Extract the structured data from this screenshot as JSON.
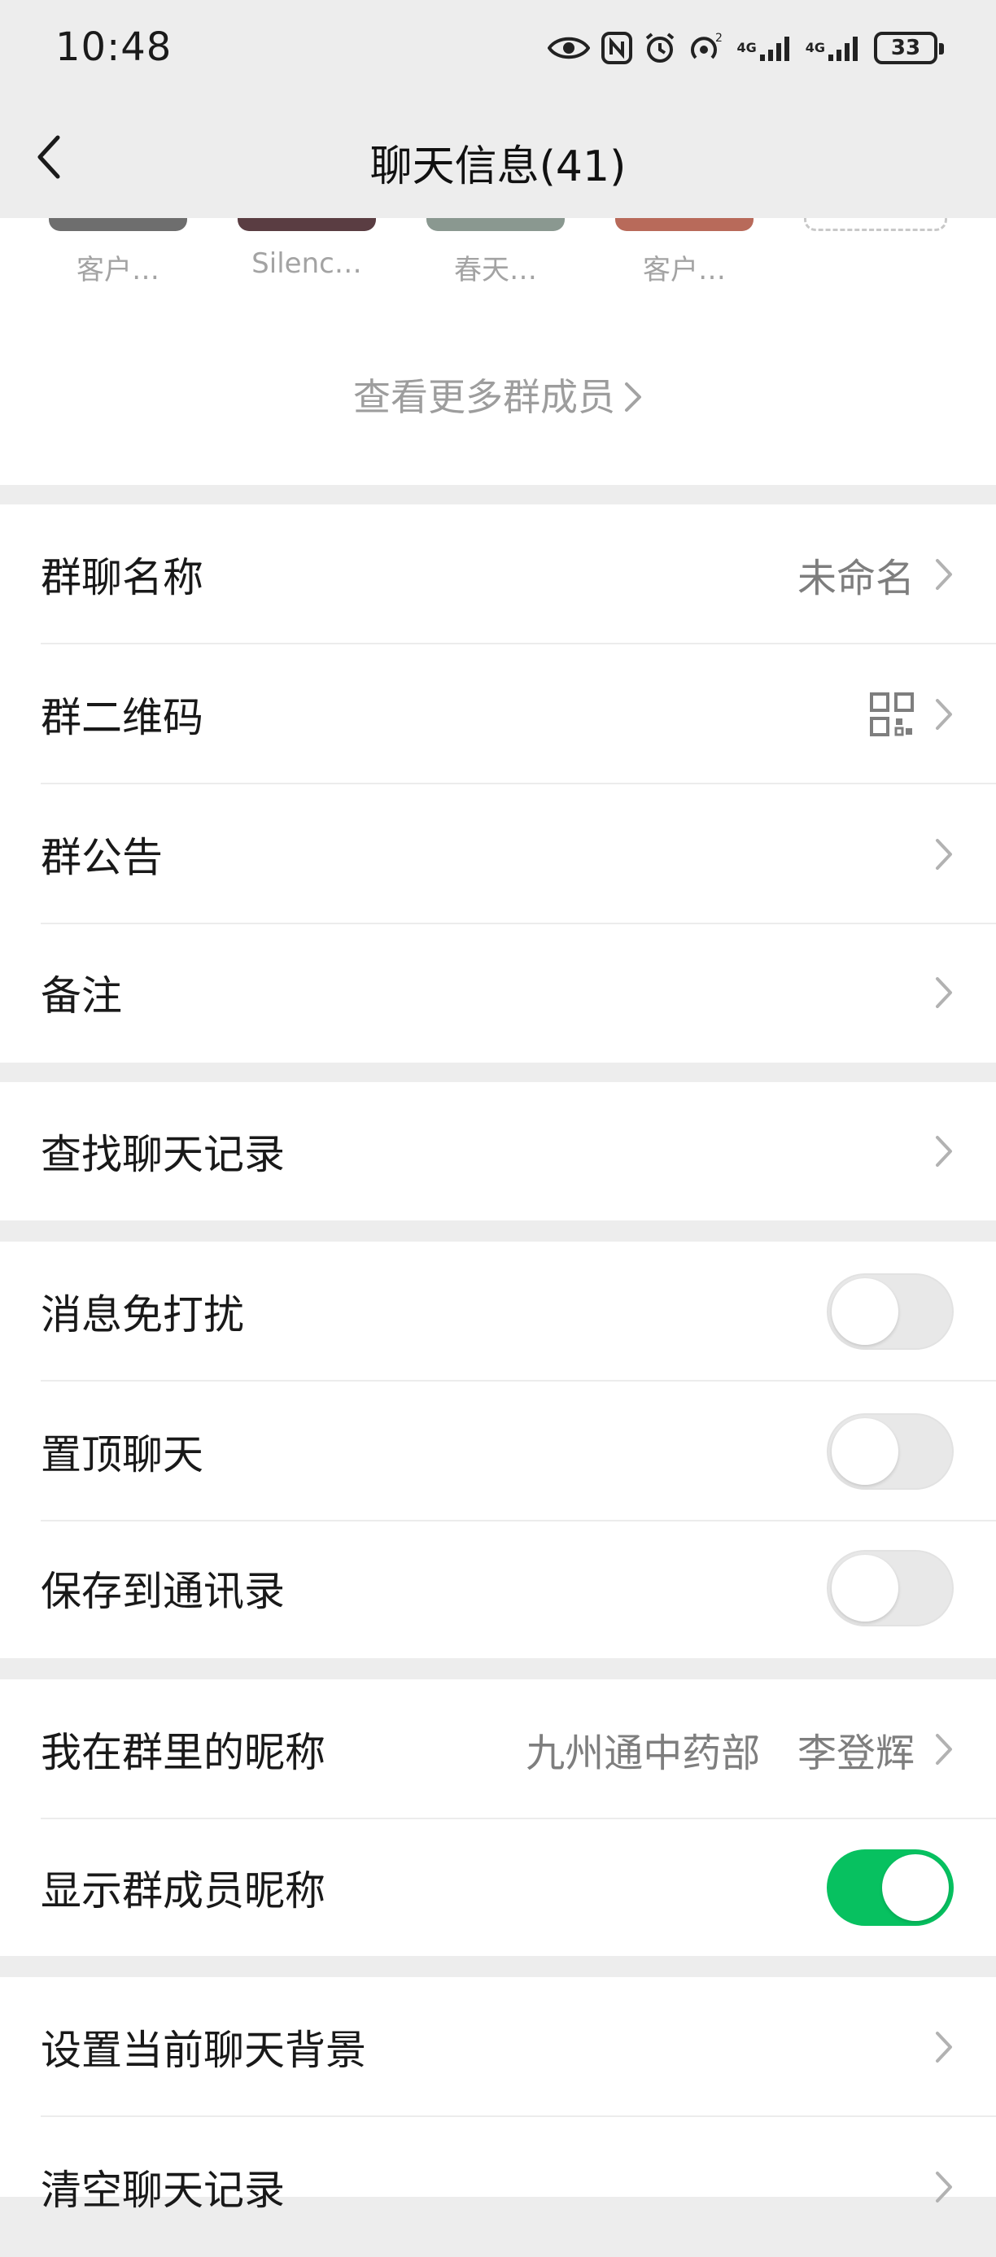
{
  "status_bar": {
    "time": "10:48",
    "icons": [
      "eye-icon",
      "nfc-icon",
      "alarm-icon",
      "hotspot-icon",
      "signal-icon",
      "signal-icon"
    ],
    "signal_labels": [
      "4G",
      "4G"
    ],
    "battery": "33"
  },
  "header": {
    "title": "聊天信息(41)"
  },
  "members": {
    "names": [
      "客户…",
      "Silenc…",
      "春天…",
      "客户…"
    ],
    "avatar_colors": [
      "#6e6e6e",
      "#5a3d42",
      "#8a9890",
      "#b86a5a"
    ],
    "more_label": "查看更多群成员"
  },
  "group1": [
    {
      "label": "群聊名称",
      "value": "未命名"
    },
    {
      "label": "群二维码",
      "value": ""
    },
    {
      "label": "群公告",
      "value": ""
    },
    {
      "label": "备注",
      "value": ""
    }
  ],
  "group2": [
    {
      "label": "查找聊天记录"
    }
  ],
  "group3": [
    {
      "label": "消息免打扰",
      "on": false
    },
    {
      "label": "置顶聊天",
      "on": false
    },
    {
      "label": "保存到通讯录",
      "on": false
    }
  ],
  "group4": {
    "nickname_label": "我在群里的昵称",
    "nickname_value": "九州通中药部   李登辉",
    "show_nick_label": "显示群成员昵称",
    "show_nick_on": true
  },
  "group5": [
    {
      "label": "设置当前聊天背景"
    },
    {
      "label": "清空聊天记录"
    }
  ],
  "colors": {
    "accent": "#07c160",
    "background": "#ededed"
  }
}
